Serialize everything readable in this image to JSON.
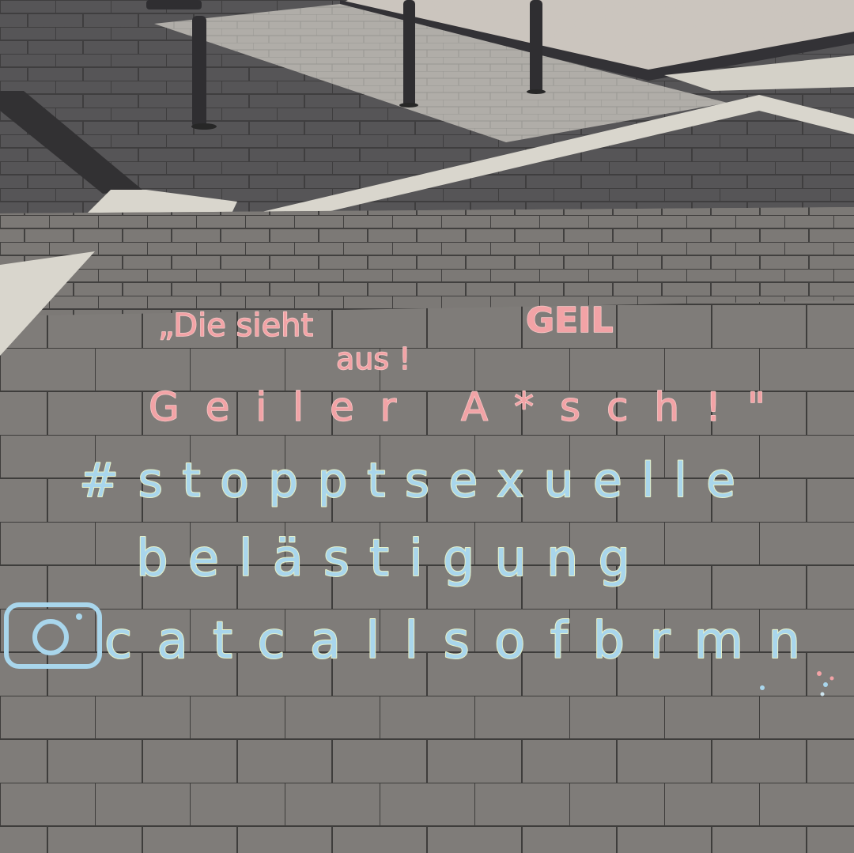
{
  "scene": {
    "description_colors": {
      "upper_pavement": "#4f4e50",
      "lower_pavement": "#7e7b78",
      "white_strip": "#dedbd2",
      "wall": "#cfc9c2",
      "pink_chalk": "#f2a3a6",
      "blue_chalk": "#a9d6ec"
    }
  },
  "chalk_text": {
    "line1_left": "„Die sieht",
    "line1_right": "GEIL",
    "line2": "aus !",
    "line3": "Geiler A*sch!\"",
    "line4": "#stopptsexuelle",
    "line5": "belästigung",
    "handle": "catcallsofbrmn"
  },
  "icons": {
    "instagram": "instagram-icon"
  }
}
